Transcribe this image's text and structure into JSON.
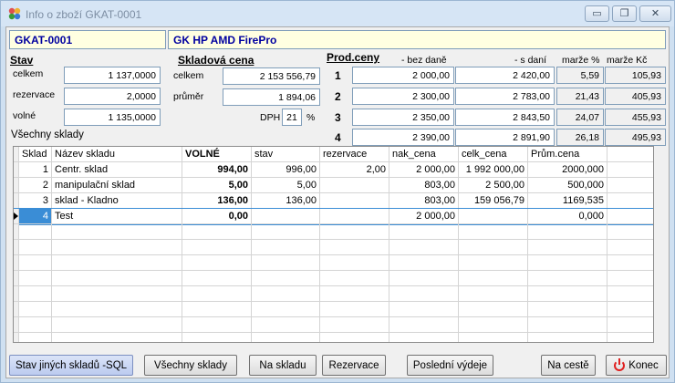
{
  "window": {
    "title": "Info o zboží GKAT-0001",
    "min_glyph": "▭",
    "max_glyph": "❐",
    "close_glyph": "✕"
  },
  "header": {
    "code": "GKAT-0001",
    "name": "GK HP AMD FirePro"
  },
  "stav": {
    "title": "Stav",
    "rows": [
      {
        "label": "celkem",
        "value": "1 137,0000"
      },
      {
        "label": "rezervace",
        "value": "2,0000"
      },
      {
        "label": "volné",
        "value": "1 135,0000"
      }
    ],
    "all_label": "Všechny sklady"
  },
  "skladova_cena": {
    "title": "Skladová cena",
    "celkem_label": "celkem",
    "celkem_value": "2 153 556,79",
    "prumer_label": "průměr",
    "prumer_value": "1 894,06",
    "dph_label": "DPH",
    "dph_value": "21",
    "percent": "%"
  },
  "prod_ceny": {
    "title": "Prod.ceny",
    "col_bez": "- bez daně",
    "col_s": "- s daní",
    "col_marze_pct": "marže %",
    "col_marze_kc": "marže Kč",
    "rows": [
      {
        "n": "1",
        "bez": "2 000,00",
        "s": "2 420,00",
        "pct": "5,59",
        "kc": "105,93"
      },
      {
        "n": "2",
        "bez": "2 300,00",
        "s": "2 783,00",
        "pct": "21,43",
        "kc": "405,93"
      },
      {
        "n": "3",
        "bez": "2 350,00",
        "s": "2 843,50",
        "pct": "24,07",
        "kc": "455,93"
      },
      {
        "n": "4",
        "bez": "2 390,00",
        "s": "2 891,90",
        "pct": "26,18",
        "kc": "495,93"
      }
    ]
  },
  "grid": {
    "columns": [
      "Sklad",
      "Název skladu",
      "VOLNÉ",
      "stav",
      "rezervace",
      "nak_cena",
      "celk_cena",
      "Prům.cena"
    ],
    "rows": [
      [
        "1",
        "Centr. sklad",
        "994,00",
        "996,00",
        "2,00",
        "2 000,00",
        "1 992 000,00",
        "2000,000"
      ],
      [
        "2",
        "manipulační sklad",
        "5,00",
        "5,00",
        "",
        "803,00",
        "2 500,00",
        "500,000"
      ],
      [
        "3",
        "sklad - Kladno",
        "136,00",
        "136,00",
        "",
        "803,00",
        "159 056,79",
        "1169,535"
      ],
      [
        "4",
        "Test",
        "0,00",
        "",
        "",
        "2 000,00",
        "",
        "0,000"
      ]
    ]
  },
  "buttons": {
    "stav_jinych": "Stav jiných skladů -SQL",
    "vsechny": "Všechny sklady",
    "na_skladu": "Na skladu",
    "rezervace": "Rezervace",
    "posledni": "Poslední výdeje",
    "na_ceste": "Na cestě",
    "konec": "Konec"
  },
  "colors": {
    "accent": "#3a8dd6",
    "header_bg": "#ffffe1",
    "header_text": "#0000a0"
  }
}
